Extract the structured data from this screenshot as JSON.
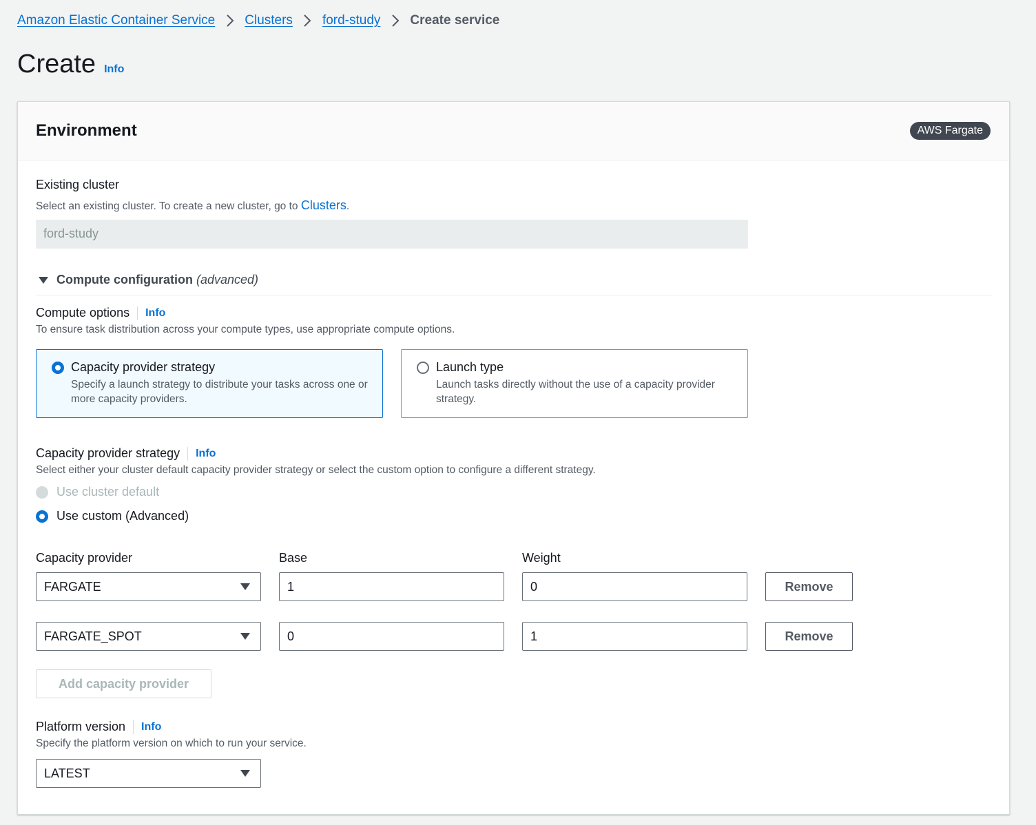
{
  "breadcrumb": {
    "items": [
      "Amazon Elastic Container Service",
      "Clusters",
      "ford-study"
    ],
    "current": "Create service"
  },
  "page": {
    "title": "Create",
    "info": "Info"
  },
  "environment": {
    "title": "Environment",
    "badge": "AWS Fargate",
    "existing_cluster": {
      "label": "Existing cluster",
      "desc_prefix": "Select an existing cluster. To create a new cluster, go to ",
      "desc_link": "Clusters",
      "desc_suffix": ".",
      "value": "ford-study"
    },
    "compute_config": {
      "label": "Compute configuration",
      "suffix": "(advanced)"
    },
    "compute_options": {
      "label": "Compute options",
      "info": "Info",
      "desc": "To ensure task distribution across your compute types, use appropriate compute options.",
      "tiles": [
        {
          "title": "Capacity provider strategy",
          "desc": "Specify a launch strategy to distribute your tasks across one or more capacity providers.",
          "selected": true
        },
        {
          "title": "Launch type",
          "desc": "Launch tasks directly without the use of a capacity provider strategy.",
          "selected": false
        }
      ]
    },
    "cps": {
      "label": "Capacity provider strategy",
      "info": "Info",
      "desc": "Select either your cluster default capacity provider strategy or select the custom option to configure a different strategy.",
      "options": [
        "Use cluster default",
        "Use custom (Advanced)"
      ],
      "selected": "Use custom (Advanced)"
    },
    "providers": {
      "headers": {
        "provider": "Capacity provider",
        "base": "Base",
        "weight": "Weight"
      },
      "rows": [
        {
          "provider": "FARGATE",
          "base": "1",
          "weight": "0",
          "remove": "Remove"
        },
        {
          "provider": "FARGATE_SPOT",
          "base": "0",
          "weight": "1",
          "remove": "Remove"
        }
      ],
      "add_label": "Add capacity provider"
    },
    "platform": {
      "label": "Platform version",
      "info": "Info",
      "desc": "Specify the platform version on which to run your service.",
      "value": "LATEST"
    }
  },
  "colors": {
    "link": "#0972d3",
    "badge_bg": "#414750",
    "selected_tile_bg": "#f1faff"
  }
}
